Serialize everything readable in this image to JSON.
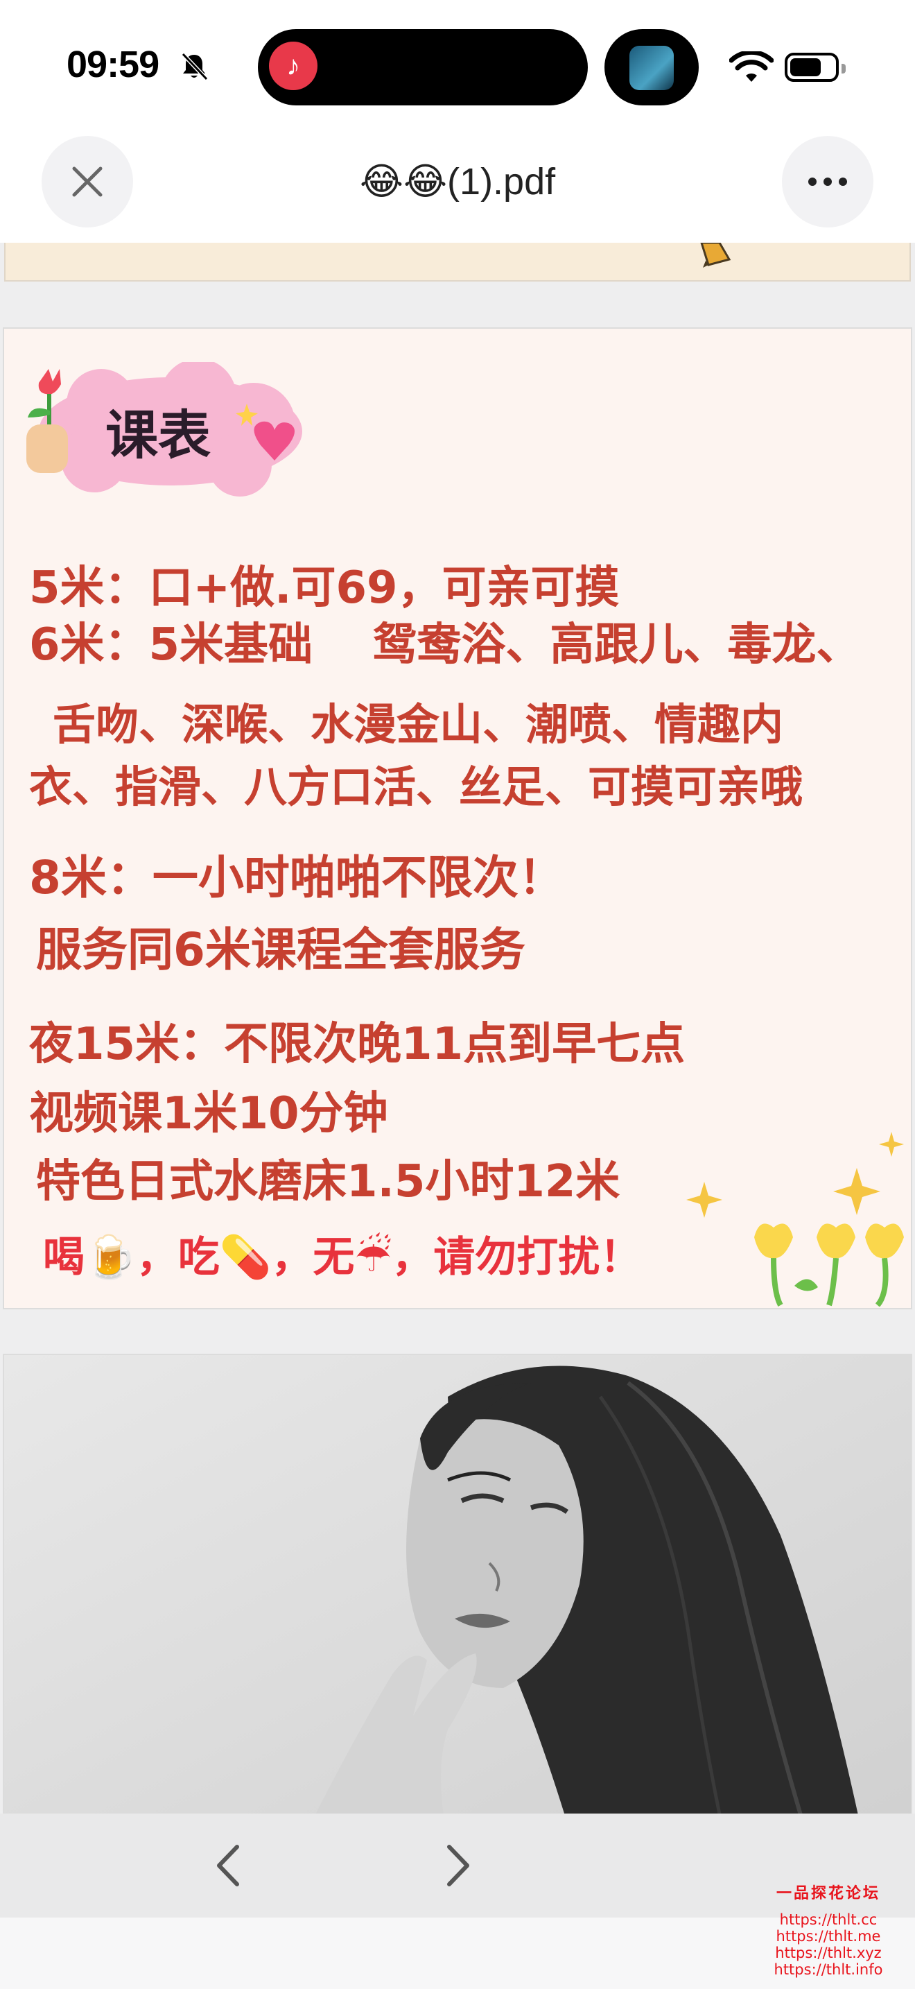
{
  "status_bar": {
    "time": "09:59",
    "icons": [
      "bell-slash-icon",
      "netease-music-icon",
      "app-thumbnail-icon",
      "wifi-icon",
      "battery-icon"
    ]
  },
  "header": {
    "title": "😂😂(1).pdf",
    "close_icon": "close-icon",
    "more_icon": "more-icon"
  },
  "schedule_page": {
    "heading": "课表",
    "lines": [
      "5米：口+做.可69，可亲可摸",
      "6米：5米基础　 鸳鸯浴、高跟儿、毒龙、",
      "舌吻、深喉、水漫金山、潮喷、情趣内",
      "衣、指滑、八方口活、丝足、可摸可亲哦",
      "8米：一小时啪啪不限次！",
      "服务同6米课程全套服务",
      "夜15米：不限次晚11点到早七点",
      "视频课1米10分钟",
      "特色日式水磨床1.5小时12米",
      "喝🍺，吃💊，无☔，请勿打扰！"
    ]
  },
  "toolbar": {
    "prev_icon": "chevron-left-icon",
    "next_icon": "chevron-right-icon"
  },
  "watermark": {
    "title": "一品探花论坛",
    "urls": [
      "https://thlt.cc",
      "https://thlt.me",
      "https://thlt.xyz",
      "https://thlt.info"
    ]
  },
  "colors": {
    "schedule_text": "#c64030",
    "notice_text": "#e8323c",
    "watermark": "#e8141c",
    "cloud_pink": "#f7b7d2"
  }
}
